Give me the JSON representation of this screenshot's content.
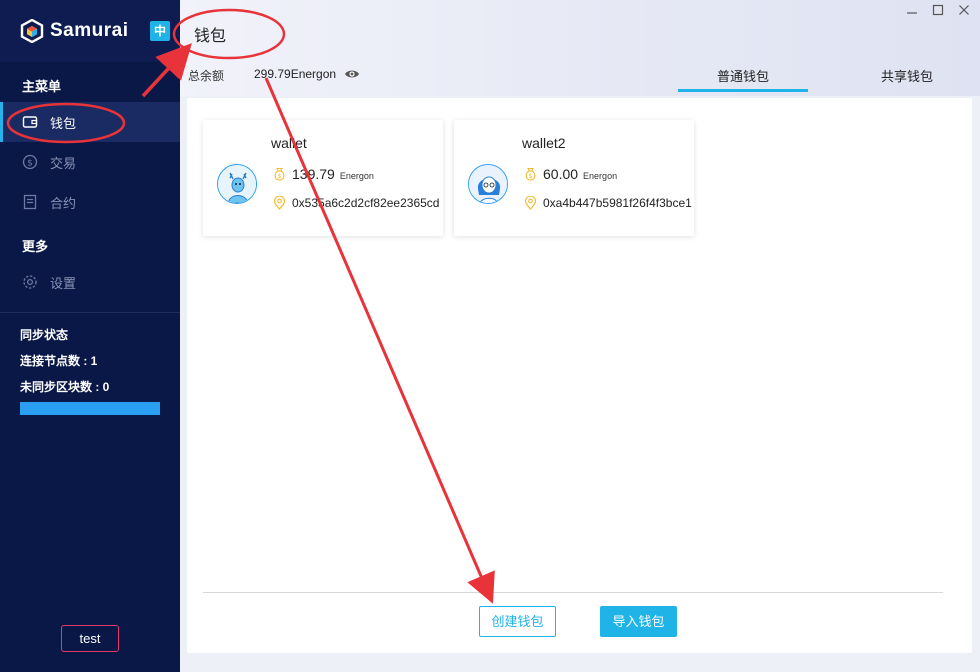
{
  "sidebar": {
    "brand": "Samurai",
    "lang": "中",
    "main_menu_title": "主菜单",
    "items": [
      {
        "label": "钱包",
        "icon": "wallet-icon",
        "active": true
      },
      {
        "label": "交易",
        "icon": "dollar-icon",
        "active": false
      },
      {
        "label": "合约",
        "icon": "contract-icon",
        "active": false
      }
    ],
    "more_title": "更多",
    "settings_label": "设置",
    "sync": {
      "title": "同步状态",
      "nodes_label": "连接节点数 : 1",
      "blocks_label": "未同步区块数 : 0",
      "progress": 1.0
    },
    "user": "test"
  },
  "header": {
    "title": "钱包",
    "total_label": "总余额",
    "total_value": "299.79Energon",
    "tabs": [
      {
        "label": "普通钱包",
        "active": true
      },
      {
        "label": "共享钱包",
        "active": false
      }
    ]
  },
  "wallets": [
    {
      "name": "wallet",
      "balance": "139.79",
      "unit": "Energon",
      "address": "0x535a6c2d2cf82ee2365cd",
      "avatar": "deer-avatar-icon"
    },
    {
      "name": "wallet2",
      "balance": "60.00",
      "unit": "Energon",
      "address": "0xa4b447b5981f26f4f3bce1",
      "avatar": "girl-avatar-icon"
    }
  ],
  "actions": {
    "create": "创建钱包",
    "import": "导入钱包"
  },
  "colors": {
    "sidebar": "#0a1848",
    "accent": "#1fb3e8",
    "annotation": "#e8333a"
  }
}
